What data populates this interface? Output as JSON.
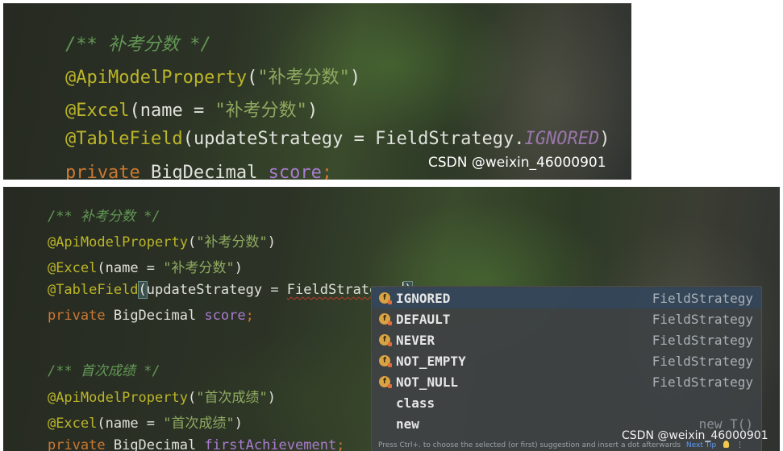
{
  "top_snippet": {
    "lines": [
      {
        "comment": "/** 补考分数 */"
      },
      {
        "anno": "@ApiModelProperty",
        "open": "(",
        "str": "\"补考分数\"",
        "close": ")"
      },
      {
        "anno": "@Excel",
        "open": "(",
        "plain": "name = ",
        "str": "\"补考分数\"",
        "close": ")"
      },
      {
        "anno": "@TableField",
        "open": "(",
        "plain": "updateStrategy = FieldStrategy.",
        "enum": "IGNORED",
        "close": ")"
      },
      {
        "kw": "private",
        "type": " BigDecimal ",
        "field": "score",
        "end": ";"
      }
    ],
    "watermark": "CSDN @weixin_46000901"
  },
  "bottom_snippet": {
    "lines": [
      {
        "comment": "/** 补考分数 */"
      },
      {
        "anno": "@ApiModelProperty",
        "open": "(",
        "str": "\"补考分数\"",
        "close": ")"
      },
      {
        "anno": "@Excel",
        "open": "(",
        "plain": "name = ",
        "str": "\"补考分数\"",
        "close": ")"
      },
      {
        "anno": "@TableField",
        "open": "(",
        "plain": "updateStrategy = ",
        "squiggle": "FieldStrategy.",
        "close": ")"
      },
      {
        "kw": "private",
        "type": " BigDecimal ",
        "field": "score",
        "end": ";"
      },
      {
        "comment": "/** 首次成绩 */"
      },
      {
        "anno": "@ApiModelProperty",
        "open": "(",
        "str": "\"首次成绩\"",
        "close": ")"
      },
      {
        "anno": "@Excel",
        "open": "(",
        "plain": "name = ",
        "str": "\"首次成绩\"",
        "close": ")"
      },
      {
        "kw": "private",
        "type": " BigDecimal ",
        "field": "firstAchievement",
        "end": ";"
      }
    ],
    "watermark": "CSDN @weixin_46000901"
  },
  "completion_popup": {
    "items": [
      {
        "icon": "enum-constant-icon",
        "name": "IGNORED",
        "type": "FieldStrategy",
        "selected": true
      },
      {
        "icon": "enum-constant-icon",
        "name": "DEFAULT",
        "type": "FieldStrategy"
      },
      {
        "icon": "enum-constant-icon",
        "name": "NEVER",
        "type": "FieldStrategy"
      },
      {
        "icon": "enum-constant-icon",
        "name": "NOT_EMPTY",
        "type": "FieldStrategy"
      },
      {
        "icon": "enum-constant-icon",
        "name": "NOT_NULL",
        "type": "FieldStrategy"
      },
      {
        "icon": "",
        "name": "class",
        "type": ""
      },
      {
        "icon": "",
        "name": "new",
        "type": "new T()"
      }
    ],
    "icon_letter": "f",
    "hint": "Press Ctrl+. to choose the selected (or first) suggestion and insert a dot afterwards",
    "next_tip": "Next Tip",
    "menu_glyph": "⋮"
  },
  "colors": {
    "comment": "#629755",
    "annotation": "#bbb529",
    "string": "#8fa960",
    "keyword": "#cc7832",
    "field": "#a97bcf",
    "enum_constant": "#9876aa",
    "popup_bg": "#3e4244",
    "selected_bg": "#32465a"
  }
}
